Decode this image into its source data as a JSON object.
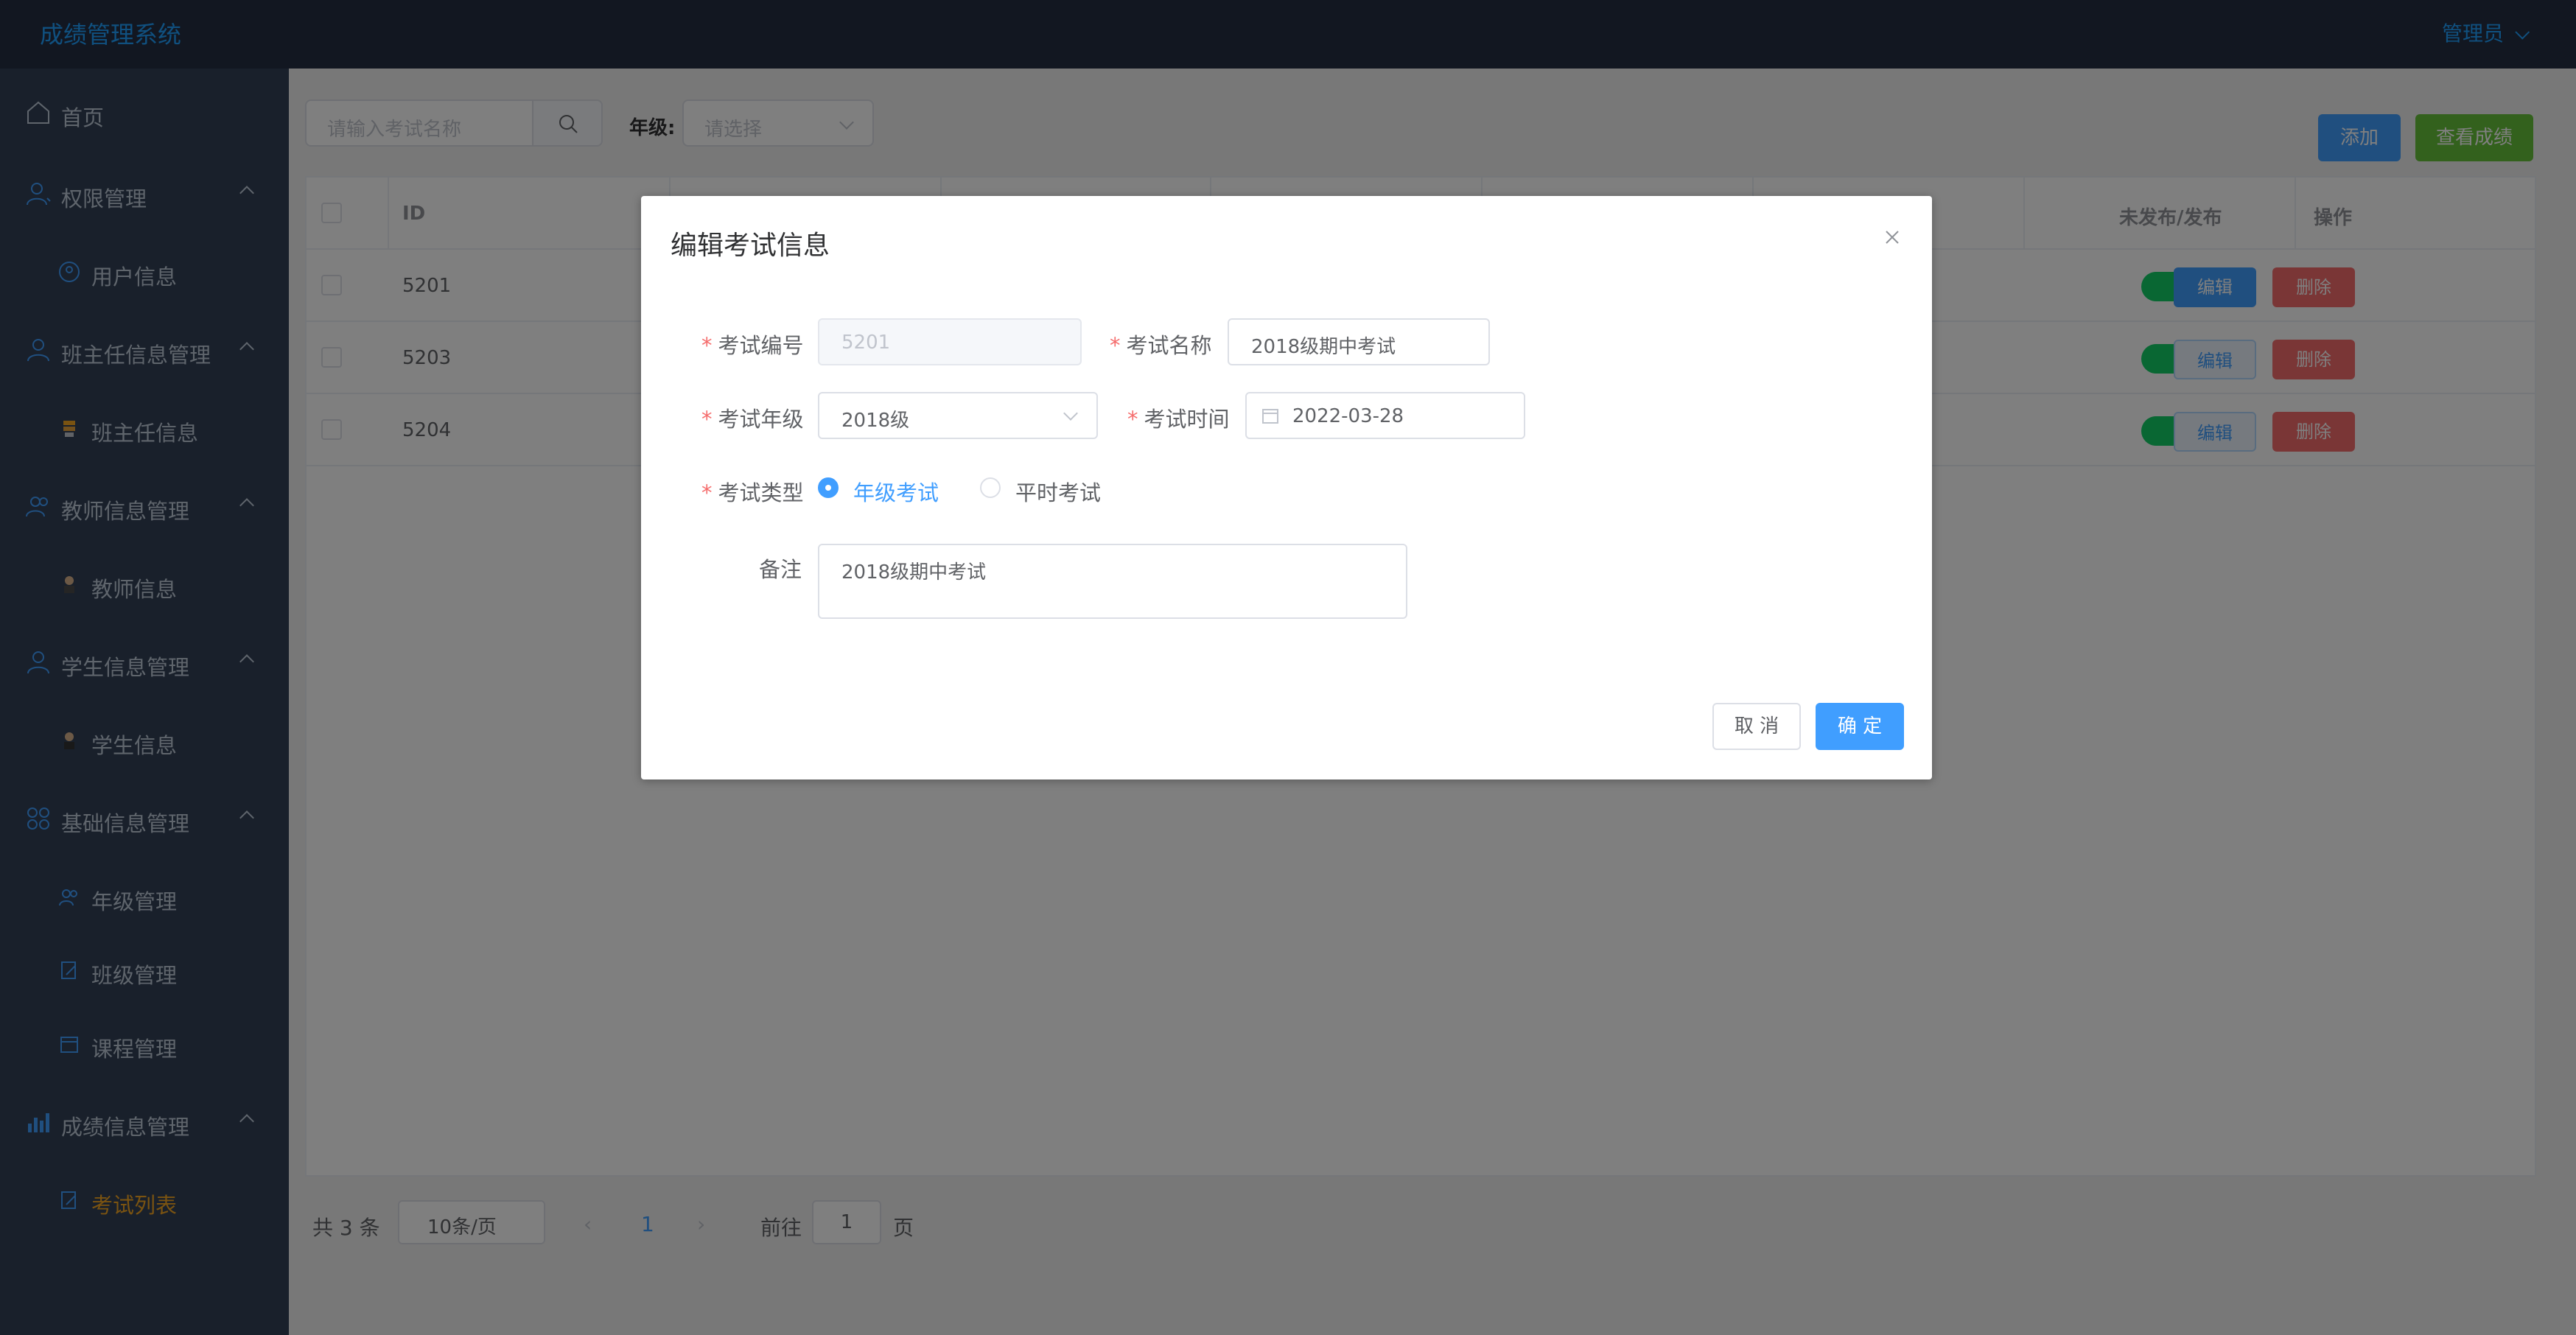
{
  "header": {
    "brand": "成绩管理系统",
    "user": "管理员"
  },
  "sidebar": {
    "items": [
      {
        "label": "首页"
      },
      {
        "label": "权限管理"
      },
      {
        "label": "用户信息"
      },
      {
        "label": "班主任信息管理"
      },
      {
        "label": "班主任信息"
      },
      {
        "label": "教师信息管理"
      },
      {
        "label": "教师信息"
      },
      {
        "label": "学生信息管理"
      },
      {
        "label": "学生信息"
      },
      {
        "label": "基础信息管理"
      },
      {
        "label": "年级管理"
      },
      {
        "label": "班级管理"
      },
      {
        "label": "课程管理"
      },
      {
        "label": "成绩信息管理"
      },
      {
        "label": "考试列表"
      }
    ],
    "active_color": "#f5a623"
  },
  "toolbar": {
    "search_placeholder": "请输入考试名称",
    "grade_label": "年级:",
    "grade_placeholder": "请选择",
    "add_label": "添加",
    "view_scores_label": "查看成绩"
  },
  "table": {
    "headers": {
      "id": "ID",
      "publish": "未发布/发布",
      "actions": "操作"
    },
    "rows": [
      {
        "id": "5201",
        "published": true,
        "edit": "编辑",
        "delete": "删除"
      },
      {
        "id": "5203",
        "published": true,
        "edit": "编辑",
        "delete": "删除"
      },
      {
        "id": "5204",
        "published": true,
        "edit": "编辑",
        "delete": "删除"
      }
    ]
  },
  "pager": {
    "total": "共 3 条",
    "page_size": "10条/页",
    "current": "1",
    "goto_label": "前往",
    "goto_value": "1",
    "page_suffix": "页"
  },
  "dialog": {
    "title": "编辑考试信息",
    "fields": {
      "exam_no_label": "考试编号",
      "exam_no_value": "5201",
      "exam_name_label": "考试名称",
      "exam_name_value": "2018级期中考试",
      "exam_grade_label": "考试年级",
      "exam_grade_value": "2018级",
      "exam_time_label": "考试时间",
      "exam_time_value": "2022-03-28",
      "exam_type_label": "考试类型",
      "type_option_grade": "年级考试",
      "type_option_regular": "平时考试",
      "selected_type": "年级考试",
      "remark_label": "备注",
      "remark_value": "2018级期中考试"
    },
    "cancel_label": "取 消",
    "ok_label": "确 定"
  },
  "colors": {
    "primary": "#409eff",
    "success": "#67c23a",
    "danger": "#f56c6c",
    "switch_on": "#13ce66",
    "header_bg": "#242f42",
    "sidebar_bg": "#324157"
  }
}
